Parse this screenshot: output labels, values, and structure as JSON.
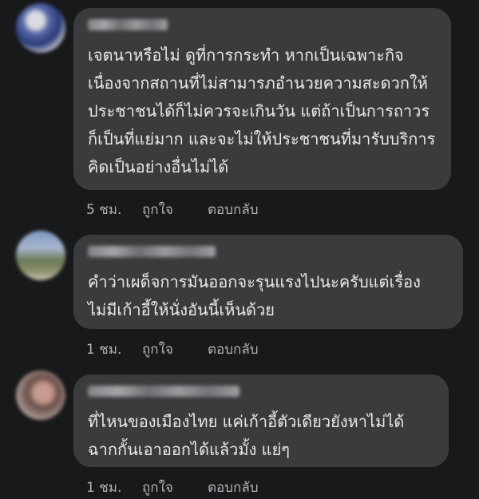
{
  "comments": [
    {
      "text": "เจตนาหรือไม่ ดูที่การกระทำ หากเป็นเฉพาะกิจเนื่องจากสถานที่ไม่สามารภอำนวยความสะดวกให้ประชาชนได้ก็ไม่ควรจะเกินวัน แต่ถ้าเป็นการถาวรก็เป็นที่แย่มาก และจะไม่ให้ประชาชนที่มารับบริการคิดเป็นอย่างอื่นไม่ได้",
      "time": "5 ชม.",
      "like": "ถูกใจ",
      "reply": "ตอบกลับ"
    },
    {
      "text": "คำว่าเผด็จการมันออกจะรุนแรงไปนะครับแต่เรื่องไม่มีเก้าอี้ให้นั่งอันนี้เห็นด้วย",
      "time": "1 ชม.",
      "like": "ถูกใจ",
      "reply": "ตอบกลับ"
    },
    {
      "text": "ที่ไหนของเมืองไทย แค่เก้าอี้ตัวเดียวยังหาไม่ได้ ฉากกั้นเอาออกได้แล้วมั้ง แย่ๆ",
      "time": "1 ชม.",
      "like": "ถูกใจ",
      "reply": "ตอบกลับ"
    }
  ],
  "colors": {
    "background": "#18191a",
    "bubble": "#3a3b3c",
    "text": "#e8e9ec",
    "meta": "#b0b3b8"
  }
}
